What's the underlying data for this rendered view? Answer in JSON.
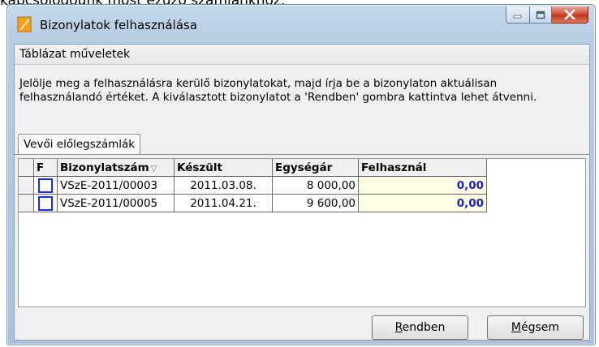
{
  "background_caption": "kapcsolódóunk most ezúzó számlánkhoz.",
  "window": {
    "title": "Bizonylatok felhasználása",
    "caption_buttons": [
      "minimize-icon",
      "maximize-icon",
      "close-icon"
    ]
  },
  "menu": {
    "table_ops": "Táblázat műveletek"
  },
  "instructions": "Jelölje meg a felhasználásra kerülő bizonylatokat, majd írja be a bizonylaton aktuálisan felhasználandó értéket.  A kiválasztott bizonylatot a 'Rendben' gombra kattintva lehet átvenni.",
  "tab": {
    "label": "Vevői előlegszámlák"
  },
  "grid": {
    "columns": [
      "F",
      "Bizonylatszám",
      "Készült",
      "Egységár",
      "Felhasznál"
    ],
    "rows": [
      {
        "checked": false,
        "number": "VSzE-2011/00003",
        "date": "2011.03.08.",
        "price": "8 000,00",
        "use": "0,00"
      },
      {
        "checked": false,
        "number": "VSzE-2011/00005",
        "date": "2011.04.21.",
        "price": "9 600,00",
        "use": "0,00"
      }
    ]
  },
  "buttons": {
    "ok_mnemonic": "R",
    "ok_rest": "endben",
    "cancel_mnemonic": "M",
    "cancel_rest": "égsem"
  },
  "colors": {
    "accent_value": "#1a23c9",
    "edit_cell": "#fffde3",
    "checkbox": "#1b2fd0"
  }
}
